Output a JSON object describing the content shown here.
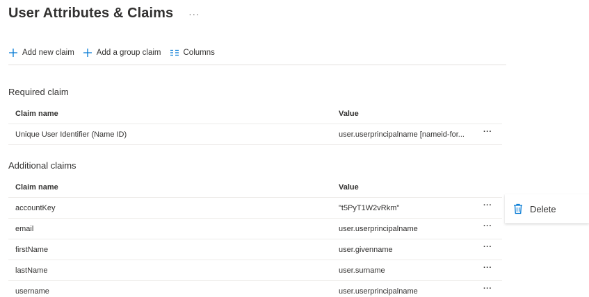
{
  "page": {
    "title": "User Attributes & Claims",
    "more": "···"
  },
  "toolbar": {
    "add_new_claim": "Add new claim",
    "add_group_claim": "Add a group claim",
    "columns": "Columns"
  },
  "required": {
    "section_title": "Required claim",
    "headers": {
      "name": "Claim name",
      "value": "Value"
    },
    "rows": [
      {
        "name": "Unique User Identifier (Name ID)",
        "value": "user.userprincipalname [nameid-for...",
        "more": "···"
      }
    ]
  },
  "additional": {
    "section_title": "Additional claims",
    "headers": {
      "name": "Claim name",
      "value": "Value"
    },
    "rows": [
      {
        "name": "accountKey",
        "value": "\"t5PyT1W2vRkm\"",
        "more": "···"
      },
      {
        "name": "email",
        "value": "user.userprincipalname",
        "more": "···"
      },
      {
        "name": "firstName",
        "value": "user.givenname",
        "more": "···"
      },
      {
        "name": "lastName",
        "value": "user.surname",
        "more": "···"
      },
      {
        "name": "username",
        "value": "user.userprincipalname",
        "more": "···"
      }
    ]
  },
  "context_menu": {
    "delete_label": "Delete",
    "delete_icon": "trash-icon"
  },
  "colors": {
    "accent": "#0078d4",
    "text": "#323130",
    "divider": "#edebe9"
  }
}
